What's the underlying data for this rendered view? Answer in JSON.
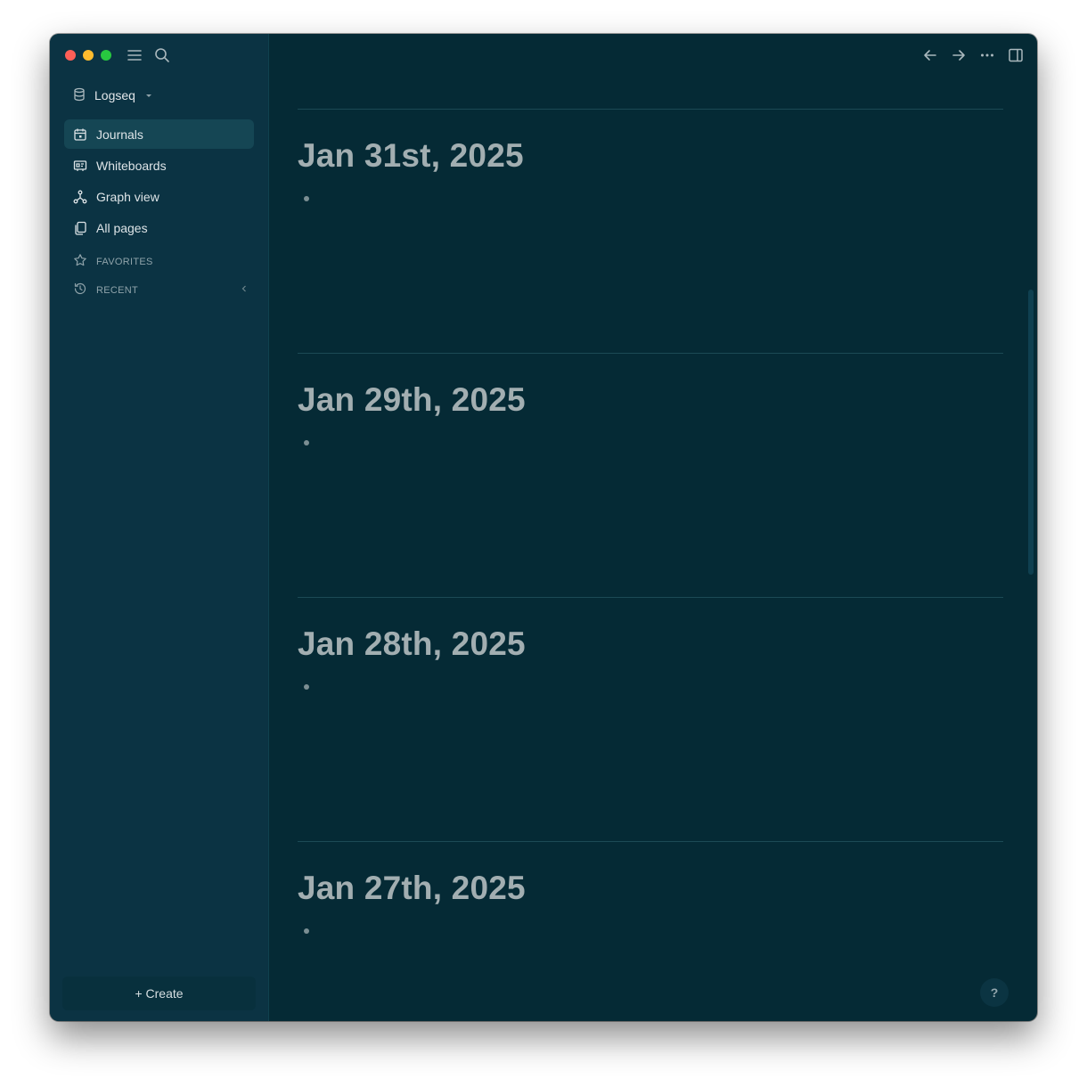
{
  "app": {
    "graph_name": "Logseq"
  },
  "sidebar": {
    "items": [
      {
        "label": "Journals",
        "icon": "calendar-icon",
        "active": true
      },
      {
        "label": "Whiteboards",
        "icon": "whiteboard-icon",
        "active": false
      },
      {
        "label": "Graph view",
        "icon": "graph-icon",
        "active": false
      },
      {
        "label": "All pages",
        "icon": "pages-icon",
        "active": false
      }
    ],
    "favorites_label": "FAVORITES",
    "recent_label": "RECENT",
    "create_label": "+ Create"
  },
  "journals": [
    {
      "title": "Jan 31st, 2025"
    },
    {
      "title": "Jan 29th, 2025"
    },
    {
      "title": "Jan 28th, 2025"
    },
    {
      "title": "Jan 27th, 2025"
    }
  ],
  "help_label": "?",
  "colors": {
    "main_bg": "#052a35",
    "sidebar_bg": "#0b3343",
    "active_item_bg": "#154654",
    "title_color": "#a2aeb1"
  }
}
